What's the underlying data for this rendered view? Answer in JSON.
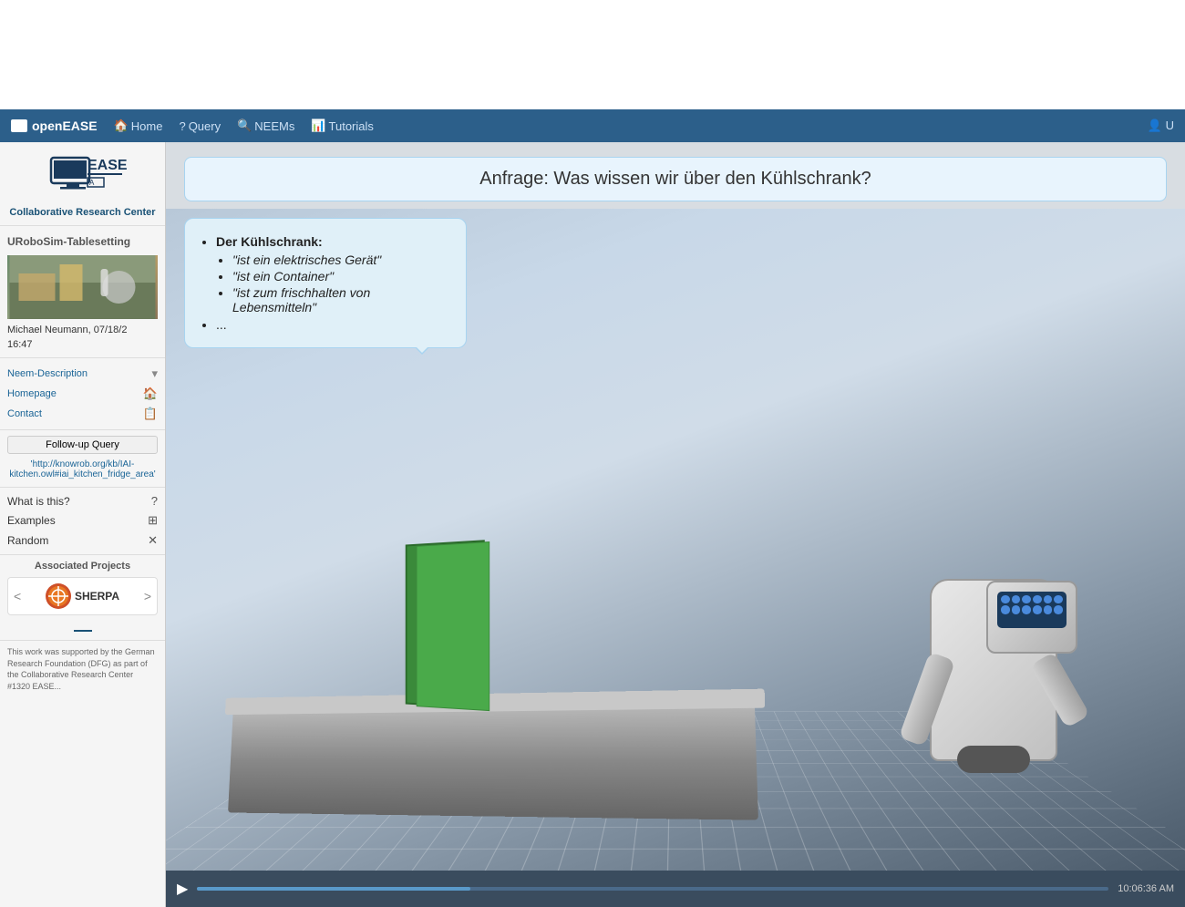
{
  "navbar": {
    "brand": "openEASE",
    "items": [
      {
        "label": "Home",
        "icon": "🏠"
      },
      {
        "label": "Query",
        "icon": "?"
      },
      {
        "label": "NEEMs",
        "icon": "🔍"
      },
      {
        "label": "Tutorials",
        "icon": "📊"
      }
    ],
    "user_icon": "👤"
  },
  "sidebar": {
    "logo_subtitle": "Collaborative Research Center",
    "neem_title": "URoboSim-Tablesetting",
    "meta_author": "Michael Neumann, 07/18/2",
    "meta_time": "16:47",
    "links": [
      {
        "label": "Neem-Description",
        "icon": "▾"
      },
      {
        "label": "Homepage",
        "icon": "🏠"
      },
      {
        "label": "Contact",
        "icon": "📋"
      }
    ],
    "followup_btn": "Follow-up Query",
    "followup_link": "'http://knowrob.org/kb/IAI-kitchen.owl#iai_kitchen_fridge_area'",
    "tools": [
      {
        "label": "What is this?",
        "icon": "?"
      },
      {
        "label": "Examples",
        "icon": "⊞"
      },
      {
        "label": "Random",
        "icon": "✕"
      }
    ],
    "associated_label": "Associated Projects",
    "sherpa_label": "SHERPA",
    "footer_text": "This work was supported by the German Research Foundation (DFG) as part of the Collaborative Research Center #1320 EASE..."
  },
  "content": {
    "query_text": "Anfrage: Was wissen wir über den Kühlschrank?",
    "bubble": {
      "heading": "Der Kühlschrank:",
      "items": [
        "\"ist ein elektrisches Gerät\"",
        "\"ist ein Container\"",
        "\"ist zum frischhalten von Lebensmitteln\""
      ],
      "extra": "..."
    },
    "video_time": "10:06:36 AM"
  }
}
